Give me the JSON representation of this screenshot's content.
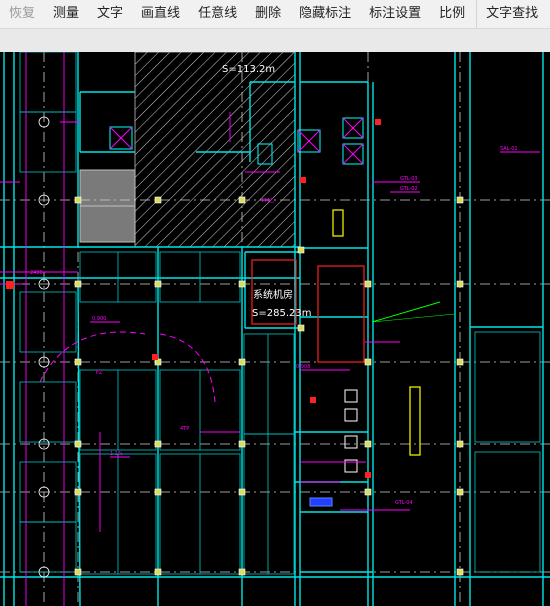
{
  "toolbar": {
    "items": [
      {
        "label": "恢复",
        "enabled": false
      },
      {
        "label": "测量",
        "enabled": true
      },
      {
        "label": "文字",
        "enabled": true
      },
      {
        "label": "画直线",
        "enabled": true
      },
      {
        "label": "任意线",
        "enabled": true
      },
      {
        "label": "删除",
        "enabled": true
      },
      {
        "label": "隐藏标注",
        "enabled": true
      },
      {
        "label": "标注设置",
        "enabled": true
      },
      {
        "label": "比例",
        "enabled": true
      },
      {
        "label": "文字查找",
        "enabled": true
      }
    ]
  },
  "drawing": {
    "area_label_top": "S=113.2m",
    "area_label_main": "S=285.23m",
    "room_label": "系统机房",
    "colors": {
      "background": "#000000",
      "cyan": "#00ffff",
      "magenta": "#ff00ff",
      "red": "#ff0000",
      "green": "#00ff00",
      "yellow": "#ffff00",
      "white": "#ffffff",
      "gray": "#8a8a8a"
    }
  }
}
